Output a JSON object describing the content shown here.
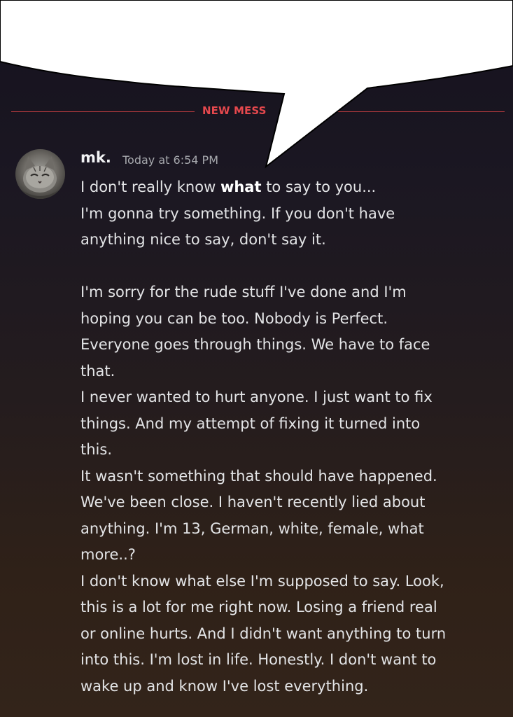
{
  "divider": {
    "label": "NEW MESS"
  },
  "message": {
    "username": "mk.",
    "timestamp": "Today at 6:54 PM",
    "first_line": {
      "before": "I don't really know ",
      "bold": "what",
      "after": " to say to you..."
    },
    "lines": [
      "I'm gonna try something. If you don't have",
      "anything nice to say, don't say it.",
      "",
      "I'm sorry for the rude stuff I've done and I'm",
      "hoping you can be too. Nobody is Perfect.",
      "Everyone goes through things. We have to face",
      "that.",
      "I never wanted to hurt anyone. I just want to fix",
      "things. And my attempt of fixing it turned into",
      "this.",
      "It wasn't something that should have happened.",
      "We've been close. I haven't recently lied about",
      "anything. I'm 13, German, white, female, what",
      "more..?",
      "I don't know what else I'm supposed to say. Look,",
      "this is a lot for me right now.  Losing a friend real",
      "or online hurts. And I didn't want anything to turn",
      "into this. I'm lost in life. Honestly. I don't want to",
      "wake up and know I've lost everything."
    ]
  },
  "colors": {
    "divider_red": "#e5484d",
    "text": "#e3e4e6",
    "timestamp": "#a6a8ad",
    "bubble": "#ffffff"
  }
}
